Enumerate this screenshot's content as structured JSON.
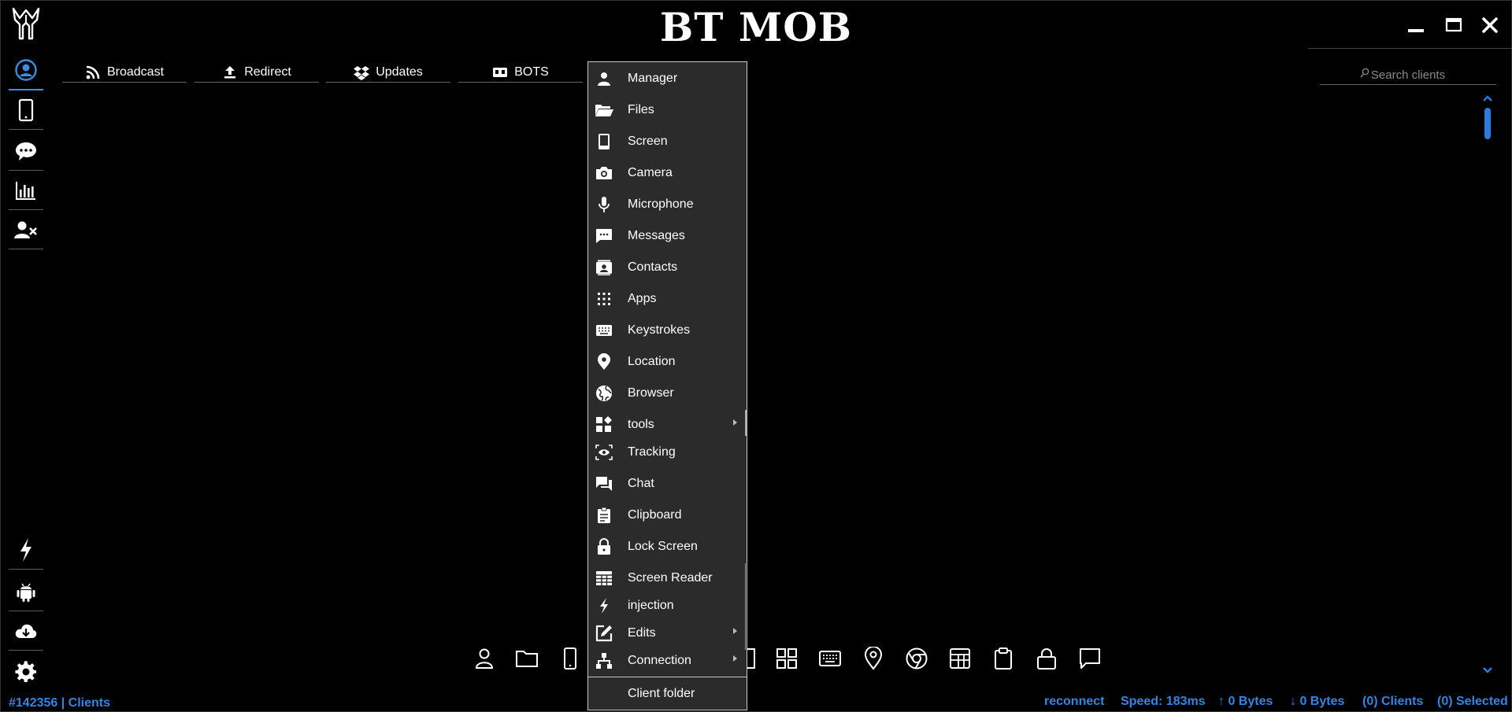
{
  "window": {
    "title": "BT MOB"
  },
  "toolbar": {
    "tabs": [
      {
        "label": "Broadcast",
        "icon": "rss-icon"
      },
      {
        "label": "Redirect",
        "icon": "upload-icon"
      },
      {
        "label": "Updates",
        "icon": "dropbox-icon"
      },
      {
        "label": "BOTS",
        "icon": "bot-icon"
      }
    ]
  },
  "search": {
    "placeholder": "Search clients"
  },
  "sidebar": {
    "top_items": [
      "user-circle-icon",
      "phone-icon",
      "chat-bubble-icon",
      "bar-chart-icon",
      "user-remove-icon"
    ],
    "bottom_items": [
      "lightning-icon",
      "android-icon",
      "cloud-download-icon",
      "gear-icon"
    ]
  },
  "context_menu": {
    "items": [
      {
        "label": "Manager",
        "icon": "person-icon"
      },
      {
        "label": "Files",
        "icon": "folder-open-icon"
      },
      {
        "label": "Screen",
        "icon": "phone-screen-icon"
      },
      {
        "label": "Camera",
        "icon": "camera-icon"
      },
      {
        "label": "Microphone",
        "icon": "microphone-icon"
      },
      {
        "label": "Messages",
        "icon": "sms-icon"
      },
      {
        "label": "Contacts",
        "icon": "contact-card-icon"
      },
      {
        "label": "Apps",
        "icon": "apps-grid-icon"
      },
      {
        "label": "Keystrokes",
        "icon": "keyboard-icon"
      },
      {
        "label": "Location",
        "icon": "location-pin-icon"
      },
      {
        "label": "Browser",
        "icon": "globe-icon"
      },
      {
        "label": "tools",
        "icon": "widgets-icon",
        "submenu": true
      },
      {
        "label": "Tracking",
        "icon": "eye-icon"
      },
      {
        "label": "Chat",
        "icon": "forum-icon"
      },
      {
        "label": "Clipboard",
        "icon": "clipboard-icon"
      },
      {
        "label": "Lock Screen",
        "icon": "lock-icon"
      },
      {
        "label": "Screen Reader",
        "icon": "table-grid-icon"
      },
      {
        "label": "injection",
        "icon": "bolt-icon"
      },
      {
        "label": "Edits",
        "icon": "edit-icon",
        "submenu": true
      },
      {
        "label": "Connection",
        "icon": "network-icon",
        "submenu": true
      },
      {
        "label": "Client folder",
        "icon": ""
      }
    ]
  },
  "bottom_toolbar": [
    "person-icon",
    "folder-icon",
    "phone-icon",
    "contact-icon",
    "apps-grid-icon",
    "keyboard-icon",
    "location-pin-icon",
    "chrome-icon",
    "table-icon",
    "clipboard-icon",
    "lock-icon",
    "chat-icon"
  ],
  "status": {
    "left": "#142356 | Clients",
    "reconnect": "reconnect",
    "speed": "Speed:  183ms",
    "upload": "↑ 0 Bytes",
    "download": "↓ 0 Bytes",
    "clients": "(0) Clients",
    "selected": "(0) Selected"
  },
  "colors": {
    "accent": "#2f86e8",
    "background": "#000000",
    "menu_bg": "#2b2b2b"
  }
}
